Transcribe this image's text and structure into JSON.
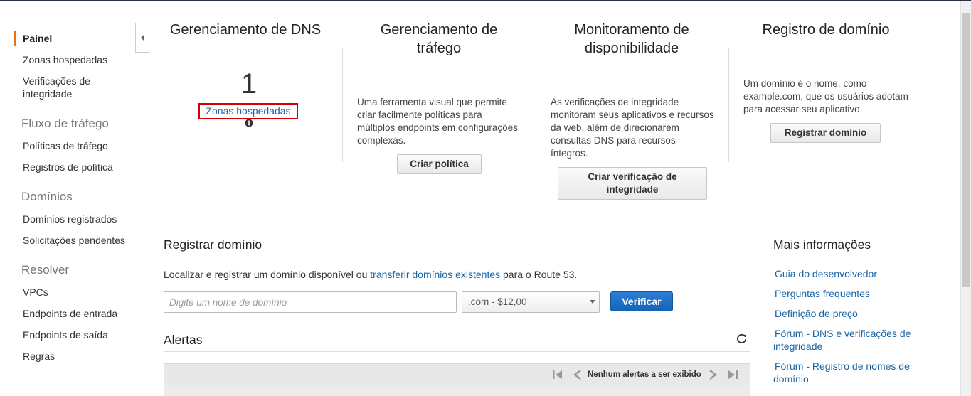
{
  "sidebar": {
    "active": "Painel",
    "items": [
      {
        "label": "Painel"
      },
      {
        "label": "Zonas hospedadas"
      },
      {
        "label": "Verificações de integridade"
      },
      {
        "label": "Políticas de tráfego"
      },
      {
        "label": "Registros de política"
      },
      {
        "label": "Domínios registrados"
      },
      {
        "label": "Solicitações pendentes"
      },
      {
        "label": "VPCs"
      },
      {
        "label": "Endpoints de entrada"
      },
      {
        "label": "Endpoints de saída"
      },
      {
        "label": "Regras"
      }
    ],
    "sections": [
      "Fluxo de tráfego",
      "Domínios",
      "Resolver"
    ]
  },
  "cards": {
    "dns": {
      "title": "Gerenciamento de DNS",
      "count": "1",
      "link": "Zonas hospedadas"
    },
    "traffic": {
      "title": "Gerenciamento de tráfego",
      "text": "Uma ferramenta visual que permite criar facilmente políticas para múltiplos endpoints em configurações complexas.",
      "button": "Criar política"
    },
    "availability": {
      "title": "Monitoramento de disponibilidade",
      "text": "As verificações de integridade monitoram seus aplicativos e recursos da web, além de direcionarem consultas DNS para recursos íntegros.",
      "button": "Criar verificação de integridade"
    },
    "registration": {
      "title": "Registro de domínio",
      "text": "Um domínio é o nome, como example.com, que os usuários adotam para acessar seu aplicativo.",
      "button": "Registrar domínio"
    }
  },
  "register": {
    "title": "Registrar domínio",
    "desc_prefix": "Localizar e registrar um domínio disponível ou",
    "desc_link": "transferir domínios existentes",
    "desc_suffix": "para o Route 53.",
    "input_placeholder": "Digite um nome de domínio",
    "tld_value": ".com - $12,00",
    "verify_button": "Verificar"
  },
  "alerts": {
    "title": "Alertas",
    "pager_text": "Nenhum alertas a ser exibido"
  },
  "more_info": {
    "title": "Mais informações",
    "links": [
      "Guia do desenvolvedor",
      "Perguntas frequentes",
      "Definição de preço",
      "Fórum - DNS e verificações de integridade",
      "Fórum - Registro de nomes de domínio"
    ]
  },
  "colors": {
    "accent": "#ec7211",
    "link": "#1a65a6",
    "primary_button": "#1f6fc5",
    "highlight": "#d40000"
  },
  "icons": [
    "chevron-left-icon",
    "info-icon",
    "refresh-icon",
    "first-page-icon",
    "prev-page-icon",
    "next-page-icon",
    "last-page-icon"
  ]
}
